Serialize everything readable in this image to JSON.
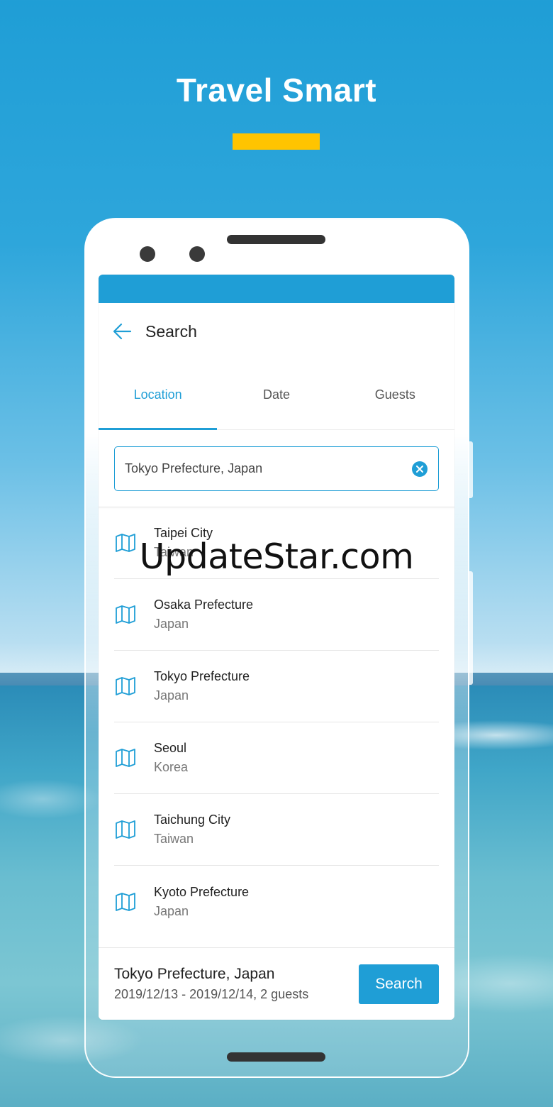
{
  "promo": {
    "title": "Travel Smart"
  },
  "header": {
    "title": "Search"
  },
  "tabs": [
    {
      "label": "Location"
    },
    {
      "label": "Date"
    },
    {
      "label": "Guests"
    }
  ],
  "search": {
    "value": "Tokyo Prefecture, Japan",
    "placeholder": ""
  },
  "results": [
    {
      "name": "Taipei City",
      "region": "Taiwan"
    },
    {
      "name": "Osaka Prefecture",
      "region": "Japan"
    },
    {
      "name": "Tokyo Prefecture",
      "region": "Japan"
    },
    {
      "name": "Seoul",
      "region": "Korea"
    },
    {
      "name": "Taichung City",
      "region": "Taiwan"
    },
    {
      "name": "Kyoto Prefecture",
      "region": "Japan"
    }
  ],
  "footer": {
    "place": "Tokyo Prefecture, Japan",
    "detail": "2019/12/13 - 2019/12/14, 2 guests",
    "button_label": "Search"
  },
  "watermark": "UpdateStar.com",
  "colors": {
    "accent": "#1f9ed6",
    "highlight": "#ffc400"
  },
  "icons": {
    "back": "arrow-left-icon",
    "clear": "clear-circle-icon",
    "result": "map-icon"
  }
}
